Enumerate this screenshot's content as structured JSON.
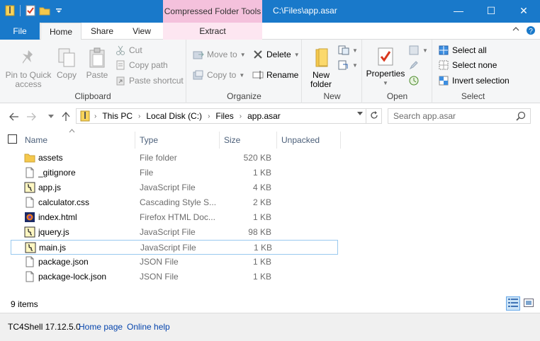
{
  "window": {
    "title": "C:\\Files\\app.asar",
    "context_tab": "Compressed Folder Tools",
    "controls": {
      "minimize": "—",
      "maximize": "☐",
      "close": "✕"
    }
  },
  "tabs": [
    {
      "label": "File"
    },
    {
      "label": "Home"
    },
    {
      "label": "Share"
    },
    {
      "label": "View"
    },
    {
      "label": "Extract"
    }
  ],
  "ribbon": {
    "clipboard": {
      "label": "Clipboard",
      "pin": "Pin to Quick access",
      "copy": "Copy",
      "paste": "Paste",
      "cut": "Cut",
      "copy_path": "Copy path",
      "paste_shortcut": "Paste shortcut"
    },
    "organize": {
      "label": "Organize",
      "move_to": "Move to",
      "copy_to": "Copy to",
      "delete": "Delete",
      "rename": "Rename"
    },
    "new": {
      "label": "New",
      "new_folder": "New folder"
    },
    "open": {
      "label": "Open",
      "properties": "Properties"
    },
    "select": {
      "label": "Select",
      "select_all": "Select all",
      "select_none": "Select none",
      "invert": "Invert selection"
    }
  },
  "address": {
    "crumbs": [
      "This PC",
      "Local Disk (C:)",
      "Files",
      "app.asar"
    ],
    "search_placeholder": "Search app.asar"
  },
  "columns": {
    "name": "Name",
    "type": "Type",
    "size": "Size",
    "unpacked": "Unpacked"
  },
  "files": [
    {
      "name": "assets",
      "type": "File folder",
      "size": "520 KB",
      "icon": "folder-icon"
    },
    {
      "name": "_gitignore",
      "type": "File",
      "size": "1 KB",
      "icon": "file-icon"
    },
    {
      "name": "app.js",
      "type": "JavaScript File",
      "size": "4 KB",
      "icon": "script-icon"
    },
    {
      "name": "calculator.css",
      "type": "Cascading Style S...",
      "size": "2 KB",
      "icon": "file-icon"
    },
    {
      "name": "index.html",
      "type": "Firefox HTML Doc...",
      "size": "1 KB",
      "icon": "firefox-icon"
    },
    {
      "name": "jquery.js",
      "type": "JavaScript File",
      "size": "98 KB",
      "icon": "script-icon"
    },
    {
      "name": "main.js",
      "type": "JavaScript File",
      "size": "1 KB",
      "icon": "script-icon",
      "selected": true
    },
    {
      "name": "package.json",
      "type": "JSON File",
      "size": "1 KB",
      "icon": "file-icon"
    },
    {
      "name": "package-lock.json",
      "type": "JSON File",
      "size": "1 KB",
      "icon": "file-icon"
    }
  ],
  "status": {
    "count": "9 items"
  },
  "footer": {
    "app": "TC4Shell 17.12.5.0",
    "home": "Home page",
    "help": "Online help"
  },
  "colors": {
    "accent": "#1979ca",
    "context_tab": "#f4c1dc",
    "selection_border": "#99c9ef",
    "link": "#0645ad"
  }
}
